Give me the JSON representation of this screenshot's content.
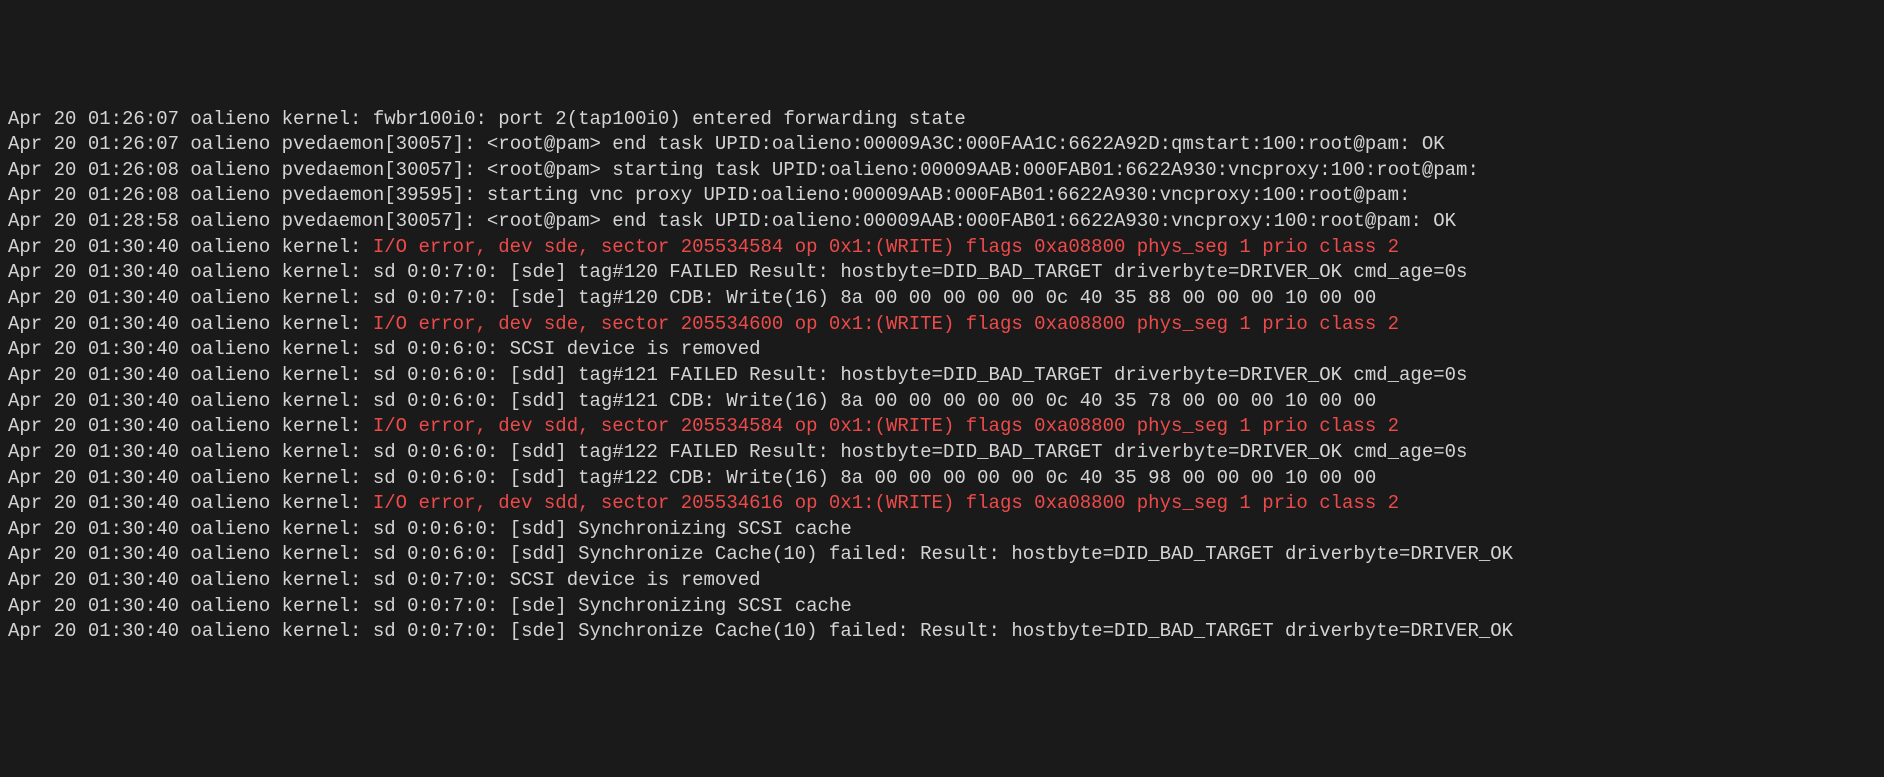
{
  "log_lines": [
    {
      "timestamp": "Apr 20 01:26:07",
      "host": "oalieno",
      "source": "kernel:",
      "message": "fwbr100i0: port 2(tap100i0) entered forwarding state",
      "error": false
    },
    {
      "timestamp": "Apr 20 01:26:07",
      "host": "oalieno",
      "source": "pvedaemon[30057]:",
      "message": "<root@pam> end task UPID:oalieno:00009A3C:000FAA1C:6622A92D:qmstart:100:root@pam: OK",
      "error": false
    },
    {
      "timestamp": "Apr 20 01:26:08",
      "host": "oalieno",
      "source": "pvedaemon[30057]:",
      "message": "<root@pam> starting task UPID:oalieno:00009AAB:000FAB01:6622A930:vncproxy:100:root@pam:",
      "error": false
    },
    {
      "timestamp": "Apr 20 01:26:08",
      "host": "oalieno",
      "source": "pvedaemon[39595]:",
      "message": "starting vnc proxy UPID:oalieno:00009AAB:000FAB01:6622A930:vncproxy:100:root@pam:",
      "error": false
    },
    {
      "timestamp": "Apr 20 01:28:58",
      "host": "oalieno",
      "source": "pvedaemon[30057]:",
      "message": "<root@pam> end task UPID:oalieno:00009AAB:000FAB01:6622A930:vncproxy:100:root@pam: OK",
      "error": false
    },
    {
      "timestamp": "Apr 20 01:30:40",
      "host": "oalieno",
      "source": "kernel:",
      "message": "I/O error, dev sde, sector 205534584 op 0x1:(WRITE) flags 0xa08800 phys_seg 1 prio class 2",
      "error": true
    },
    {
      "timestamp": "Apr 20 01:30:40",
      "host": "oalieno",
      "source": "kernel:",
      "message": "sd 0:0:7:0: [sde] tag#120 FAILED Result: hostbyte=DID_BAD_TARGET driverbyte=DRIVER_OK cmd_age=0s",
      "error": false
    },
    {
      "timestamp": "Apr 20 01:30:40",
      "host": "oalieno",
      "source": "kernel:",
      "message": "sd 0:0:7:0: [sde] tag#120 CDB: Write(16) 8a 00 00 00 00 00 0c 40 35 88 00 00 00 10 00 00",
      "error": false
    },
    {
      "timestamp": "Apr 20 01:30:40",
      "host": "oalieno",
      "source": "kernel:",
      "message": "I/O error, dev sde, sector 205534600 op 0x1:(WRITE) flags 0xa08800 phys_seg 1 prio class 2",
      "error": true
    },
    {
      "timestamp": "Apr 20 01:30:40",
      "host": "oalieno",
      "source": "kernel:",
      "message": "sd 0:0:6:0: SCSI device is removed",
      "error": false
    },
    {
      "timestamp": "Apr 20 01:30:40",
      "host": "oalieno",
      "source": "kernel:",
      "message": "sd 0:0:6:0: [sdd] tag#121 FAILED Result: hostbyte=DID_BAD_TARGET driverbyte=DRIVER_OK cmd_age=0s",
      "error": false
    },
    {
      "timestamp": "Apr 20 01:30:40",
      "host": "oalieno",
      "source": "kernel:",
      "message": "sd 0:0:6:0: [sdd] tag#121 CDB: Write(16) 8a 00 00 00 00 00 0c 40 35 78 00 00 00 10 00 00",
      "error": false
    },
    {
      "timestamp": "Apr 20 01:30:40",
      "host": "oalieno",
      "source": "kernel:",
      "message": "I/O error, dev sdd, sector 205534584 op 0x1:(WRITE) flags 0xa08800 phys_seg 1 prio class 2",
      "error": true
    },
    {
      "timestamp": "Apr 20 01:30:40",
      "host": "oalieno",
      "source": "kernel:",
      "message": "sd 0:0:6:0: [sdd] tag#122 FAILED Result: hostbyte=DID_BAD_TARGET driverbyte=DRIVER_OK cmd_age=0s",
      "error": false
    },
    {
      "timestamp": "Apr 20 01:30:40",
      "host": "oalieno",
      "source": "kernel:",
      "message": "sd 0:0:6:0: [sdd] tag#122 CDB: Write(16) 8a 00 00 00 00 00 0c 40 35 98 00 00 00 10 00 00",
      "error": false
    },
    {
      "timestamp": "Apr 20 01:30:40",
      "host": "oalieno",
      "source": "kernel:",
      "message": "I/O error, dev sdd, sector 205534616 op 0x1:(WRITE) flags 0xa08800 phys_seg 1 prio class 2",
      "error": true
    },
    {
      "timestamp": "Apr 20 01:30:40",
      "host": "oalieno",
      "source": "kernel:",
      "message": "sd 0:0:6:0: [sdd] Synchronizing SCSI cache",
      "error": false
    },
    {
      "timestamp": "Apr 20 01:30:40",
      "host": "oalieno",
      "source": "kernel:",
      "message": "sd 0:0:6:0: [sdd] Synchronize Cache(10) failed: Result: hostbyte=DID_BAD_TARGET driverbyte=DRIVER_OK",
      "error": false
    },
    {
      "timestamp": "Apr 20 01:30:40",
      "host": "oalieno",
      "source": "kernel:",
      "message": "sd 0:0:7:0: SCSI device is removed",
      "error": false
    },
    {
      "timestamp": "Apr 20 01:30:40",
      "host": "oalieno",
      "source": "kernel:",
      "message": "sd 0:0:7:0: [sde] Synchronizing SCSI cache",
      "error": false
    },
    {
      "timestamp": "Apr 20 01:30:40",
      "host": "oalieno",
      "source": "kernel:",
      "message": "sd 0:0:7:0: [sde] Synchronize Cache(10) failed: Result: hostbyte=DID_BAD_TARGET driverbyte=DRIVER_OK",
      "error": false
    }
  ]
}
